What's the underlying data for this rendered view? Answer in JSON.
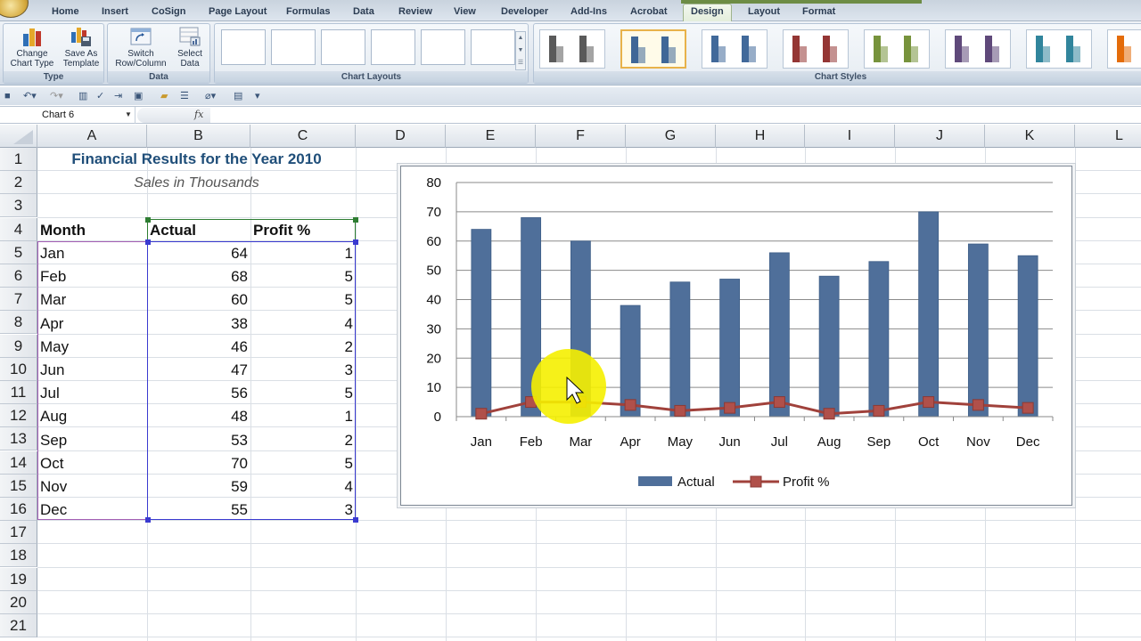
{
  "ribbon": {
    "tabs": [
      "Home",
      "Insert",
      "CoSign",
      "Page Layout",
      "Formulas",
      "Data",
      "Review",
      "View",
      "Developer",
      "Add-Ins",
      "Acrobat",
      "Design",
      "Layout",
      "Format"
    ],
    "active_tab": "Design",
    "groups": {
      "type": {
        "label": "Type",
        "change_chart_type": "Change Chart Type",
        "save_as_template": "Save As Template"
      },
      "data": {
        "label": "Data",
        "switch_row_column": "Switch Row/Column",
        "select_data": "Select Data"
      },
      "chart_layouts": {
        "label": "Chart Layouts",
        "count": 6
      },
      "chart_styles": {
        "label": "Chart Styles",
        "selected_index": 1,
        "colors": [
          "#5a5a5a",
          "#3f6797",
          "#41699a",
          "#943634",
          "#77933c",
          "#5f497a",
          "#31859c",
          "#e46c0a"
        ]
      }
    }
  },
  "formula_bar": {
    "name_box": "Chart 6",
    "fx_label": "fx",
    "value": ""
  },
  "sheet": {
    "columns": [
      "A",
      "B",
      "C",
      "D",
      "E",
      "F",
      "G",
      "H",
      "I",
      "J",
      "K",
      "L"
    ],
    "rows": [
      "1",
      "2",
      "3",
      "4",
      "5",
      "6",
      "7",
      "8",
      "9",
      "10",
      "11",
      "12",
      "13",
      "14",
      "15",
      "16",
      "17",
      "18",
      "19",
      "20",
      "21"
    ],
    "title": "Financial Results for the Year 2010",
    "subtitle": "Sales in Thousands",
    "headers": {
      "month": "Month",
      "actual": "Actual",
      "profit": "Profit %"
    },
    "table": [
      {
        "month": "Jan",
        "actual": "64",
        "profit": "1"
      },
      {
        "month": "Feb",
        "actual": "68",
        "profit": "5"
      },
      {
        "month": "Mar",
        "actual": "60",
        "profit": "5"
      },
      {
        "month": "Apr",
        "actual": "38",
        "profit": "4"
      },
      {
        "month": "May",
        "actual": "46",
        "profit": "2"
      },
      {
        "month": "Jun",
        "actual": "47",
        "profit": "3"
      },
      {
        "month": "Jul",
        "actual": "56",
        "profit": "5"
      },
      {
        "month": "Aug",
        "actual": "48",
        "profit": "1"
      },
      {
        "month": "Sep",
        "actual": "53",
        "profit": "2"
      },
      {
        "month": "Oct",
        "actual": "70",
        "profit": "5"
      },
      {
        "month": "Nov",
        "actual": "59",
        "profit": "4"
      },
      {
        "month": "Dec",
        "actual": "55",
        "profit": "3"
      }
    ]
  },
  "chart_data": {
    "type": "bar",
    "title": "",
    "categories": [
      "Jan",
      "Feb",
      "Mar",
      "Apr",
      "May",
      "Jun",
      "Jul",
      "Aug",
      "Sep",
      "Oct",
      "Nov",
      "Dec"
    ],
    "series": [
      {
        "name": "Actual",
        "kind": "bar",
        "color": "#4f6f9a",
        "values": [
          64,
          68,
          60,
          38,
          46,
          47,
          56,
          48,
          53,
          70,
          59,
          55
        ]
      },
      {
        "name": "Profit %",
        "kind": "line",
        "color": "#a0413b",
        "values": [
          1,
          5,
          5,
          4,
          2,
          3,
          5,
          1,
          2,
          5,
          4,
          3
        ]
      }
    ],
    "xlabel": "",
    "ylabel": "",
    "ylim": [
      0,
      80
    ],
    "yticks": [
      0,
      10,
      20,
      30,
      40,
      50,
      60,
      70,
      80
    ],
    "grid": true,
    "legend": "bottom"
  }
}
